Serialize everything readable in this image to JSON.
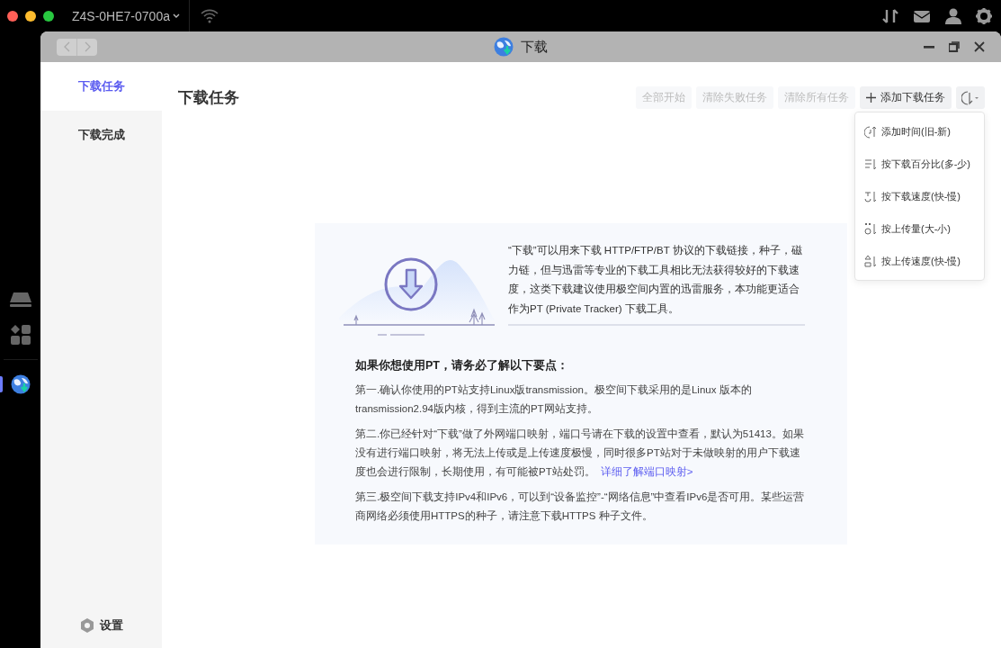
{
  "system_bar": {
    "device": "Z4S-0HE7-0700a"
  },
  "dock": [
    {
      "kind": "drive",
      "selected": false
    },
    {
      "kind": "apps",
      "selected": false
    },
    {
      "kind": "globe",
      "selected": true
    }
  ],
  "window": {
    "title": "下载"
  },
  "sidebar": {
    "items": [
      {
        "label": "下载任务",
        "selected": true
      },
      {
        "label": "下载完成",
        "selected": false
      }
    ],
    "settings": "设置"
  },
  "page_title": "下载任务",
  "toolbar": {
    "buttons": [
      {
        "label": "全部开始",
        "kind": "plain",
        "disabled": true
      },
      {
        "label": "清除失败任务",
        "kind": "plain",
        "disabled": true
      },
      {
        "label": "清除所有任务",
        "kind": "plain",
        "disabled": true
      },
      {
        "label": "添加下载任务",
        "kind": "add",
        "disabled": false
      }
    ]
  },
  "sort_menu": {
    "expanded": true,
    "items": [
      {
        "label": "添加时间(旧-新)",
        "kind": "time"
      },
      {
        "label": "按下载百分比(多-少)",
        "kind": "percent"
      },
      {
        "label": "按下载速度(快-慢)",
        "kind": "down-speed"
      },
      {
        "label": "按上传量(大-小)",
        "kind": "up-amount"
      },
      {
        "label": "按上传速度(快-慢)",
        "kind": "up-speed"
      }
    ]
  },
  "info": {
    "intro": "“下载”可以用来下载 HTTP/FTP/BT 协议的下载链接，种子，磁力链，但与迅雷等专业的下载工具相比无法获得较好的下载速度，这类下载建议使用极空间内置的迅雷服务，本功能更适合作为PT (Private Tracker) 下载工具。",
    "heading": "如果你想使用PT，请务必了解以下要点：",
    "points": [
      {
        "text": "第一.确认你使用的PT站支持Linux版transmission。极空间下载采用的是Linux 版本的 transmission2.94版内核，得到主流的PT网站支持。"
      },
      {
        "text": "第二.你已经针对“下载”做了外网端口映射，端口号请在下载的设置中查看，默认为51413。如果没有进行端口映射，将无法上传或是上传速度极慢，同时很多PT站对于未做映射的用户下载速度也会进行限制，长期使用，有可能被PT站处罚。",
        "link": "详细了解端口映射>"
      },
      {
        "text": "第三.极空间下载支持IPv4和IPv6，可以到“设备监控”-“网络信息”中查看IPv6是否可用。某些运营商网络必须使用HTTPS的种子，请注意下载HTTPS 种子文件。"
      }
    ]
  }
}
